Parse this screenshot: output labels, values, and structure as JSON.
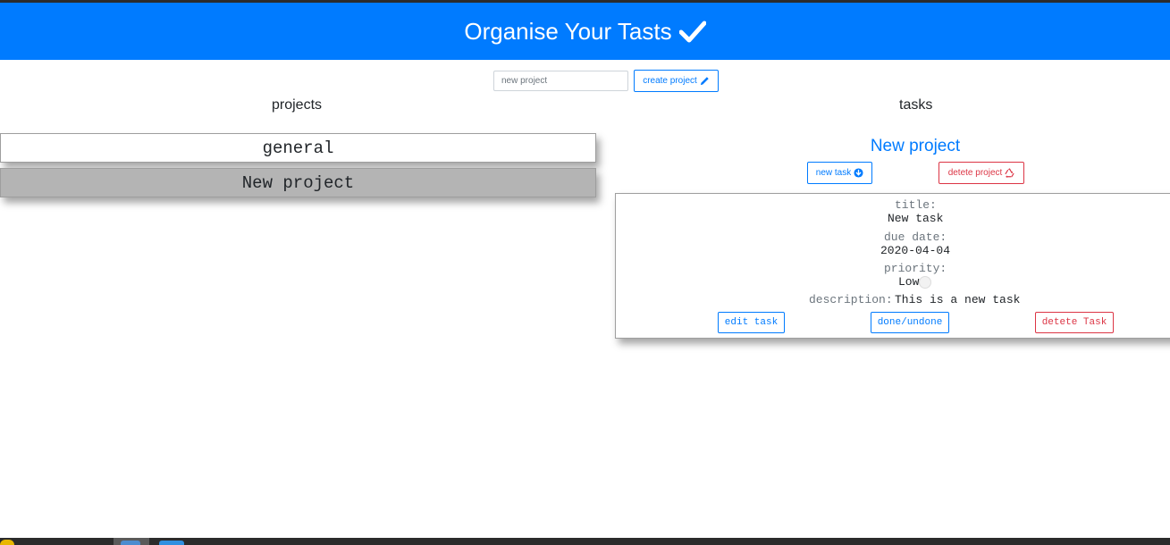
{
  "header": {
    "title": "Organise Your Tasts"
  },
  "new_project": {
    "placeholder": "new project",
    "create_label": "create project"
  },
  "projects": {
    "heading": "projects",
    "items": [
      {
        "name": "general",
        "selected": false
      },
      {
        "name": "New project",
        "selected": true
      }
    ]
  },
  "tasks": {
    "heading": "tasks",
    "current_project": "New project",
    "new_task_label": "new task",
    "delete_project_label": "detete project",
    "list": [
      {
        "title_label": "title:",
        "title": "New task",
        "due_label": "due date:",
        "due": "2020-04-04",
        "priority_label": "priority:",
        "priority": "Low",
        "description_label": "description:",
        "description": "This is a new task",
        "edit_label": "edit task",
        "done_label": "done/undone",
        "delete_label": "detete Task"
      }
    ]
  },
  "colors": {
    "primary": "#007bff",
    "danger": "#dc3545",
    "selected_project": "#b4b4b4"
  }
}
